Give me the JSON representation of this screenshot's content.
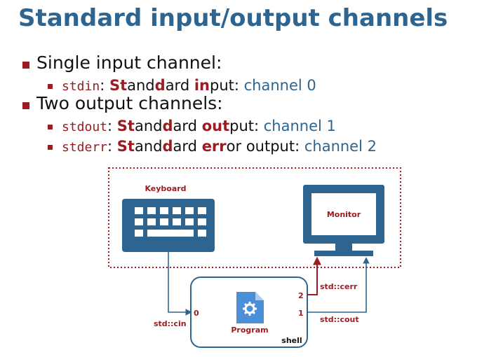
{
  "title": "Standard input/output channels",
  "bullets": {
    "input_heading": "Single input channel:",
    "output_heading": "Two output channels:",
    "stdin": {
      "code": "stdin",
      "colon": ":",
      "w1_red": "St",
      "w1_rest": "and",
      "w1_red2": "d",
      "w1_rest2": "ard",
      "w2_red": "in",
      "w2_rest": "put:",
      "channel": "channel 0"
    },
    "stdout": {
      "code": "stdout",
      "colon": ":",
      "w1_red": "St",
      "w1_rest": "and",
      "w1_red2": "d",
      "w1_rest2": "ard",
      "w2_red": "out",
      "w2_rest": "put:",
      "channel": "channel 1"
    },
    "stderr": {
      "code": "stderr",
      "colon": ":",
      "w1_red": "St",
      "w1_rest": "and",
      "w1_red2": "d",
      "w1_rest2": "ard",
      "w2_red": "err",
      "w2_rest": "or output:",
      "channel": "channel 2"
    }
  },
  "diagram": {
    "keyboard_label": "Keyboard",
    "monitor_label": "Monitor",
    "program_label": "Program",
    "shell_label": "shell",
    "port0": "0",
    "port1": "1",
    "port2": "2",
    "cin_label": "std::cin",
    "cout_label": "std::cout",
    "cerr_label": "std::cerr"
  },
  "colors": {
    "accent_blue": "#2e6590",
    "accent_red": "#9b1c22",
    "program_icon_blue": "#4a8fd8"
  }
}
